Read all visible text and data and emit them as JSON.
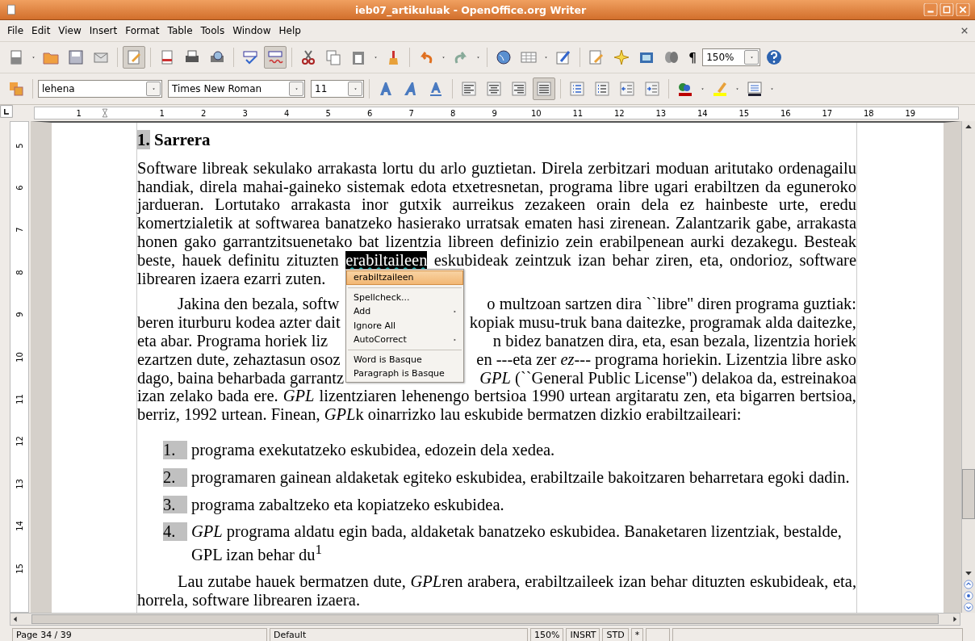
{
  "window": {
    "title": "ieb07_artikuluak - OpenOffice.org Writer"
  },
  "menu_bar": [
    "File",
    "Edit",
    "View",
    "Insert",
    "Format",
    "Table",
    "Tools",
    "Window",
    "Help"
  ],
  "standard_toolbar": {
    "edit_mode_on": true,
    "auto_spellcheck_on": true,
    "pilcrow": "¶",
    "zoom": "150%"
  },
  "format_toolbar": {
    "style": "lehena",
    "font": "Times New Roman",
    "size": "11",
    "alignment_buttons": [
      {
        "selected": false
      },
      {
        "selected": false
      },
      {
        "selected": false
      },
      {
        "selected": true
      }
    ]
  },
  "ruler": {
    "labels": [
      "1",
      "1",
      "2",
      "3",
      "4",
      "5",
      "6",
      "7",
      "8",
      "9",
      "10",
      "11",
      "12",
      "13",
      "14",
      "15",
      "16",
      "17",
      "18",
      "19"
    ]
  },
  "vertical_ruler": [
    "5",
    "6",
    "7",
    "8",
    "9",
    "10",
    "11",
    "12",
    "13",
    "14",
    "15"
  ],
  "document": {
    "heading": {
      "number": "1.",
      "text": "Sarrera"
    },
    "paragraph_1": {
      "before": "Software libreak sekulako arrakasta lortu du arlo guztietan. Direla zerbitzari moduan aritutako ordenagailu handiak, direla mahai-gaineko sistemak edota etxetresnetan, programa libre ugari erabiltzen da eguneroko jardueran. Lortutako arrakasta inor gutxik aurreikus zezakeen orain dela ez hainbeste urte, eredu komertzialetik at  softwarea banatzeko hasierako urratsak ematen hasi zirenean. Zalantzarik gabe, arrakasta honen gako garrantzitsuenetako bat lizentzia libreen definizio zein erabilpenean aurki dezakegu. Besteak beste, hauek definitu zituzten",
      "selected_word": "erabiltaileen",
      "after": "eskubideak zeintzuk izan behar ziren, eta, ondorioz, software librearen izaera ezarri zuten."
    },
    "paragraph_2": {
      "covered_lines": [
        {
          "left": "Jakina den bezala, softw",
          "right": "o multzoan sartzen dira ``libre'' diren programa guztiak:"
        },
        {
          "left": "beren iturburu kodea azter dait",
          "right": "kopiak musu-truk bana daitezke, programak alda daitezke,"
        },
        {
          "left": "eta abar. Programa horiek liz",
          "right": "n bidez banatzen dira, eta, esan bezala, lizentzia horiek"
        },
        {
          "left": "ezartzen dute, zehaztasun osoz",
          "right": "en ---eta zer *ez*--- programa horiekin. Lizentzia libre asko"
        },
        {
          "left": "dago, baina beharbada garrantz",
          "right": "*GPL* (``General Public License'') delakoa da, estreinakoa"
        }
      ],
      "rest": [
        {
          "text": "izan zelako bada ere. ",
          "italic": false
        },
        {
          "text": "GPL",
          "italic": true
        },
        {
          "text": " lizentziaren lehenengo bertsioa 1990 urtean argitaratu zen, eta bigarren bertsioa, berriz, 1992 urtean. Finean, ",
          "italic": false
        },
        {
          "text": "GPL",
          "italic": true
        },
        {
          "text": "k oinarrizko lau eskubide bermatzen dizkio erabiltzaileari:",
          "italic": false
        }
      ]
    },
    "list": [
      {
        "number": "1.",
        "text": "programa exekutatzeko eskubidea, edozein dela xedea."
      },
      {
        "number": "2.",
        "text": "programaren gainean aldaketak egiteko eskubidea, erabiltzaile bakoitzaren beharretara egoki dadin."
      },
      {
        "number": "3.",
        "text": "programa zabaltzeko eta kopiatzeko eskubidea."
      },
      {
        "number": "4.",
        "text": "*GPL* programa aldatu egin bada, aldaketak banatzeko eskubidea. Banaketaren lizentziak, bestalde, GPL izan behar du$^{1}$"
      }
    ],
    "paragraph_3": [
      {
        "text": "Lau zutabe hauek bermatzen dute, ",
        "italic": false
      },
      {
        "text": "GPL",
        "italic": true
      },
      {
        "text": "ren arabera, erabiltzaileek izan behar dituzten eskubideak, eta, horrela, software librearen izaera.",
        "italic": false
      }
    ]
  },
  "context_menu": [
    {
      "kind": "suggestion",
      "label": "erabiltzaileen",
      "selected": true
    },
    {
      "kind": "separator"
    },
    {
      "kind": "item",
      "label": "Spellcheck...",
      "submenu": false,
      "selected": false
    },
    {
      "kind": "item",
      "label": "Add",
      "submenu": true,
      "selected": false
    },
    {
      "kind": "item",
      "label": "Ignore All",
      "submenu": false,
      "selected": false
    },
    {
      "kind": "item",
      "label": "AutoCorrect",
      "submenu": true,
      "selected": false
    },
    {
      "kind": "separator"
    },
    {
      "kind": "item",
      "label": "Word is Basque",
      "submenu": false,
      "selected": false
    },
    {
      "kind": "item",
      "label": "Paragraph is Basque",
      "submenu": false,
      "selected": false
    }
  ],
  "status_bar": {
    "page": "Page 34 / 39",
    "style": "Default",
    "zoom": "150%",
    "insert_mode": "INSRT",
    "selection_mode": "STD",
    "modified": "*"
  }
}
